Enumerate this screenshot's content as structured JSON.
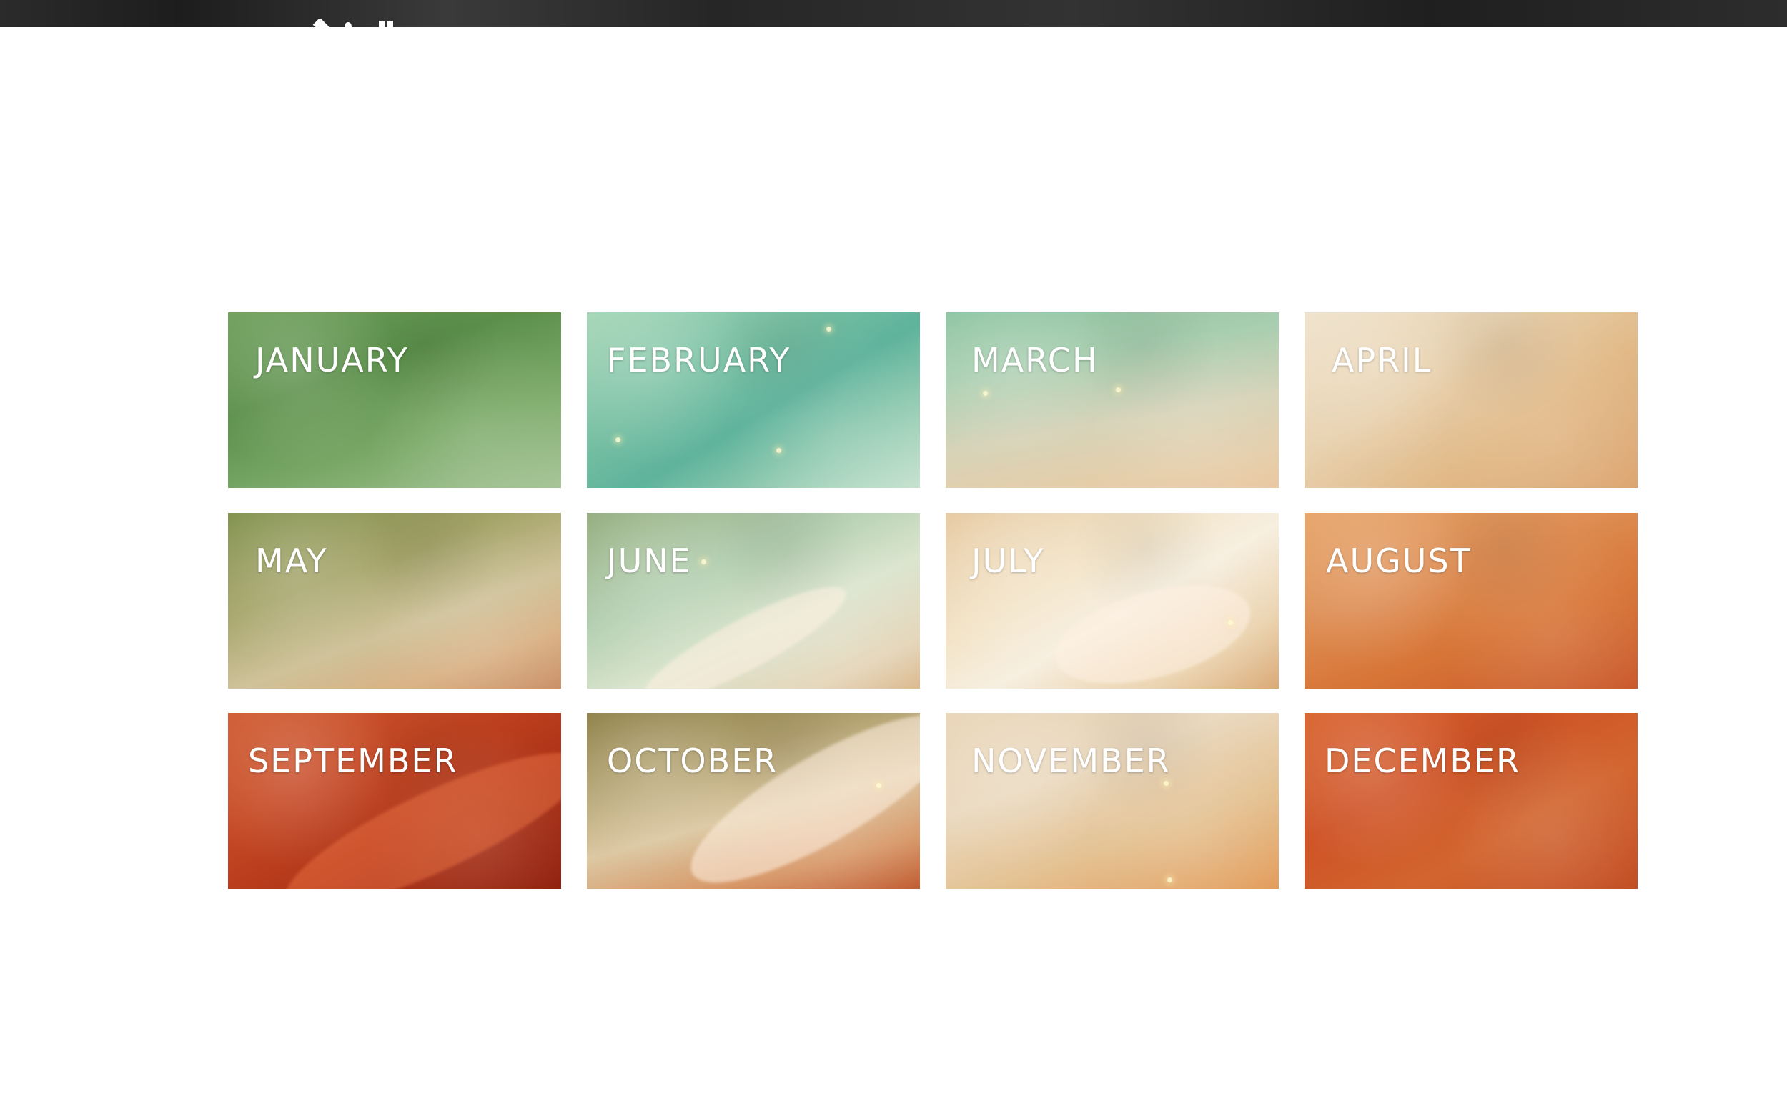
{
  "months": [
    {
      "label": "JANUARY"
    },
    {
      "label": "FEBRUARY"
    },
    {
      "label": "MARCH"
    },
    {
      "label": "APRIL"
    },
    {
      "label": "MAY"
    },
    {
      "label": "JUNE"
    },
    {
      "label": "JULY"
    },
    {
      "label": "AUGUST"
    },
    {
      "label": "SEPTEMBER"
    },
    {
      "label": "OCTOBER"
    },
    {
      "label": "NOVEMBER"
    },
    {
      "label": "DECEMBER"
    }
  ],
  "colors": {
    "page_background": "#ffffff",
    "topbar": "#2b2b2b",
    "label_text": "#ffffff"
  }
}
